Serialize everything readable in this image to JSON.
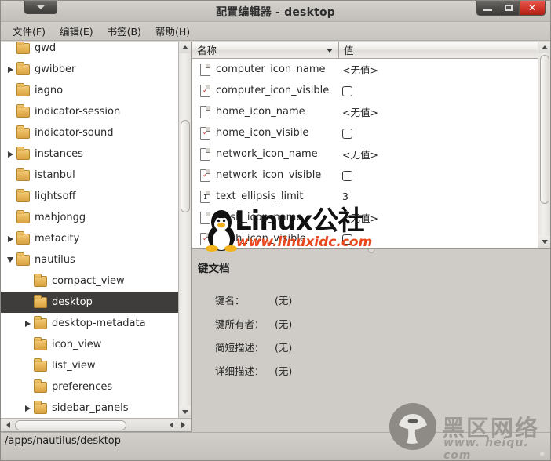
{
  "window": {
    "title": "配置编辑器 - desktop",
    "menu_button_icon": "window-menu-caret-icon",
    "buttons": {
      "minimize": "−",
      "maximize": "□",
      "close": "✕"
    }
  },
  "menubar": {
    "items": [
      {
        "label": "文件(F)",
        "name": "menu-file"
      },
      {
        "label": "编辑(E)",
        "name": "menu-edit"
      },
      {
        "label": "书签(B)",
        "name": "menu-bookmarks"
      },
      {
        "label": "帮助(H)",
        "name": "menu-help"
      }
    ]
  },
  "tree": {
    "items": [
      {
        "label": "gwd",
        "indent": 1,
        "expander": "none"
      },
      {
        "label": "gwibber",
        "indent": 1,
        "expander": "collapsed"
      },
      {
        "label": "iagno",
        "indent": 1,
        "expander": "none"
      },
      {
        "label": "indicator-session",
        "indent": 1,
        "expander": "none"
      },
      {
        "label": "indicator-sound",
        "indent": 1,
        "expander": "none"
      },
      {
        "label": "instances",
        "indent": 1,
        "expander": "collapsed"
      },
      {
        "label": "istanbul",
        "indent": 1,
        "expander": "none"
      },
      {
        "label": "lightsoff",
        "indent": 1,
        "expander": "none"
      },
      {
        "label": "mahjongg",
        "indent": 1,
        "expander": "none"
      },
      {
        "label": "metacity",
        "indent": 1,
        "expander": "collapsed"
      },
      {
        "label": "nautilus",
        "indent": 1,
        "expander": "expanded"
      },
      {
        "label": "compact_view",
        "indent": 2,
        "expander": "none"
      },
      {
        "label": "desktop",
        "indent": 2,
        "expander": "none",
        "selected": true
      },
      {
        "label": "desktop-metadata",
        "indent": 2,
        "expander": "collapsed"
      },
      {
        "label": "icon_view",
        "indent": 2,
        "expander": "none"
      },
      {
        "label": "list_view",
        "indent": 2,
        "expander": "none"
      },
      {
        "label": "preferences",
        "indent": 2,
        "expander": "none"
      },
      {
        "label": "sidebar_panels",
        "indent": 2,
        "expander": "collapsed"
      }
    ]
  },
  "keylist": {
    "columns": {
      "name": "名称",
      "value": "值"
    },
    "sort_indicator": "chevron-down-icon",
    "rows": [
      {
        "icon": "string-key-icon",
        "name": "computer_icon_name",
        "value": "<无值>",
        "type": "text"
      },
      {
        "icon": "boolean-key-icon",
        "name": "computer_icon_visible",
        "value": "",
        "type": "checkbox",
        "checked": false
      },
      {
        "icon": "string-key-icon",
        "name": "home_icon_name",
        "value": "<无值>",
        "type": "text"
      },
      {
        "icon": "boolean-key-icon",
        "name": "home_icon_visible",
        "value": "",
        "type": "checkbox",
        "checked": false
      },
      {
        "icon": "string-key-icon",
        "name": "network_icon_name",
        "value": "<无值>",
        "type": "text"
      },
      {
        "icon": "boolean-key-icon",
        "name": "network_icon_visible",
        "value": "",
        "type": "checkbox",
        "checked": false
      },
      {
        "icon": "integer-key-icon",
        "name": "text_ellipsis_limit",
        "value": "3",
        "type": "text"
      },
      {
        "icon": "string-key-icon",
        "name": "trash_icon_name",
        "value": "<无值>",
        "type": "text"
      },
      {
        "icon": "boolean-key-icon",
        "name": "trash_icon_visible",
        "value": "",
        "type": "checkbox",
        "checked": false
      }
    ]
  },
  "doc": {
    "title": "键文档",
    "rows": [
      {
        "key": "键名：",
        "value": "(无)"
      },
      {
        "key": "键所有者：",
        "value": "(无)"
      },
      {
        "key": "简短描述：",
        "value": "(无)"
      },
      {
        "key": "详细描述：",
        "value": "(无)"
      }
    ]
  },
  "statusbar": {
    "path": "/apps/nautilus/desktop"
  },
  "watermarks": {
    "linux": {
      "main": "Linux公社",
      "url": "www.linuxidc.com"
    },
    "heiqu": {
      "main": "黑区网络",
      "url": "www. heiqu. com"
    }
  },
  "colors": {
    "titlebar": "#cfccc7",
    "selection": "#3f3d3c",
    "close_button": "#d1342a",
    "folder": "#e8b659",
    "watermark_orange": "#e8481c",
    "watermark_gray": "#9d9a95"
  }
}
